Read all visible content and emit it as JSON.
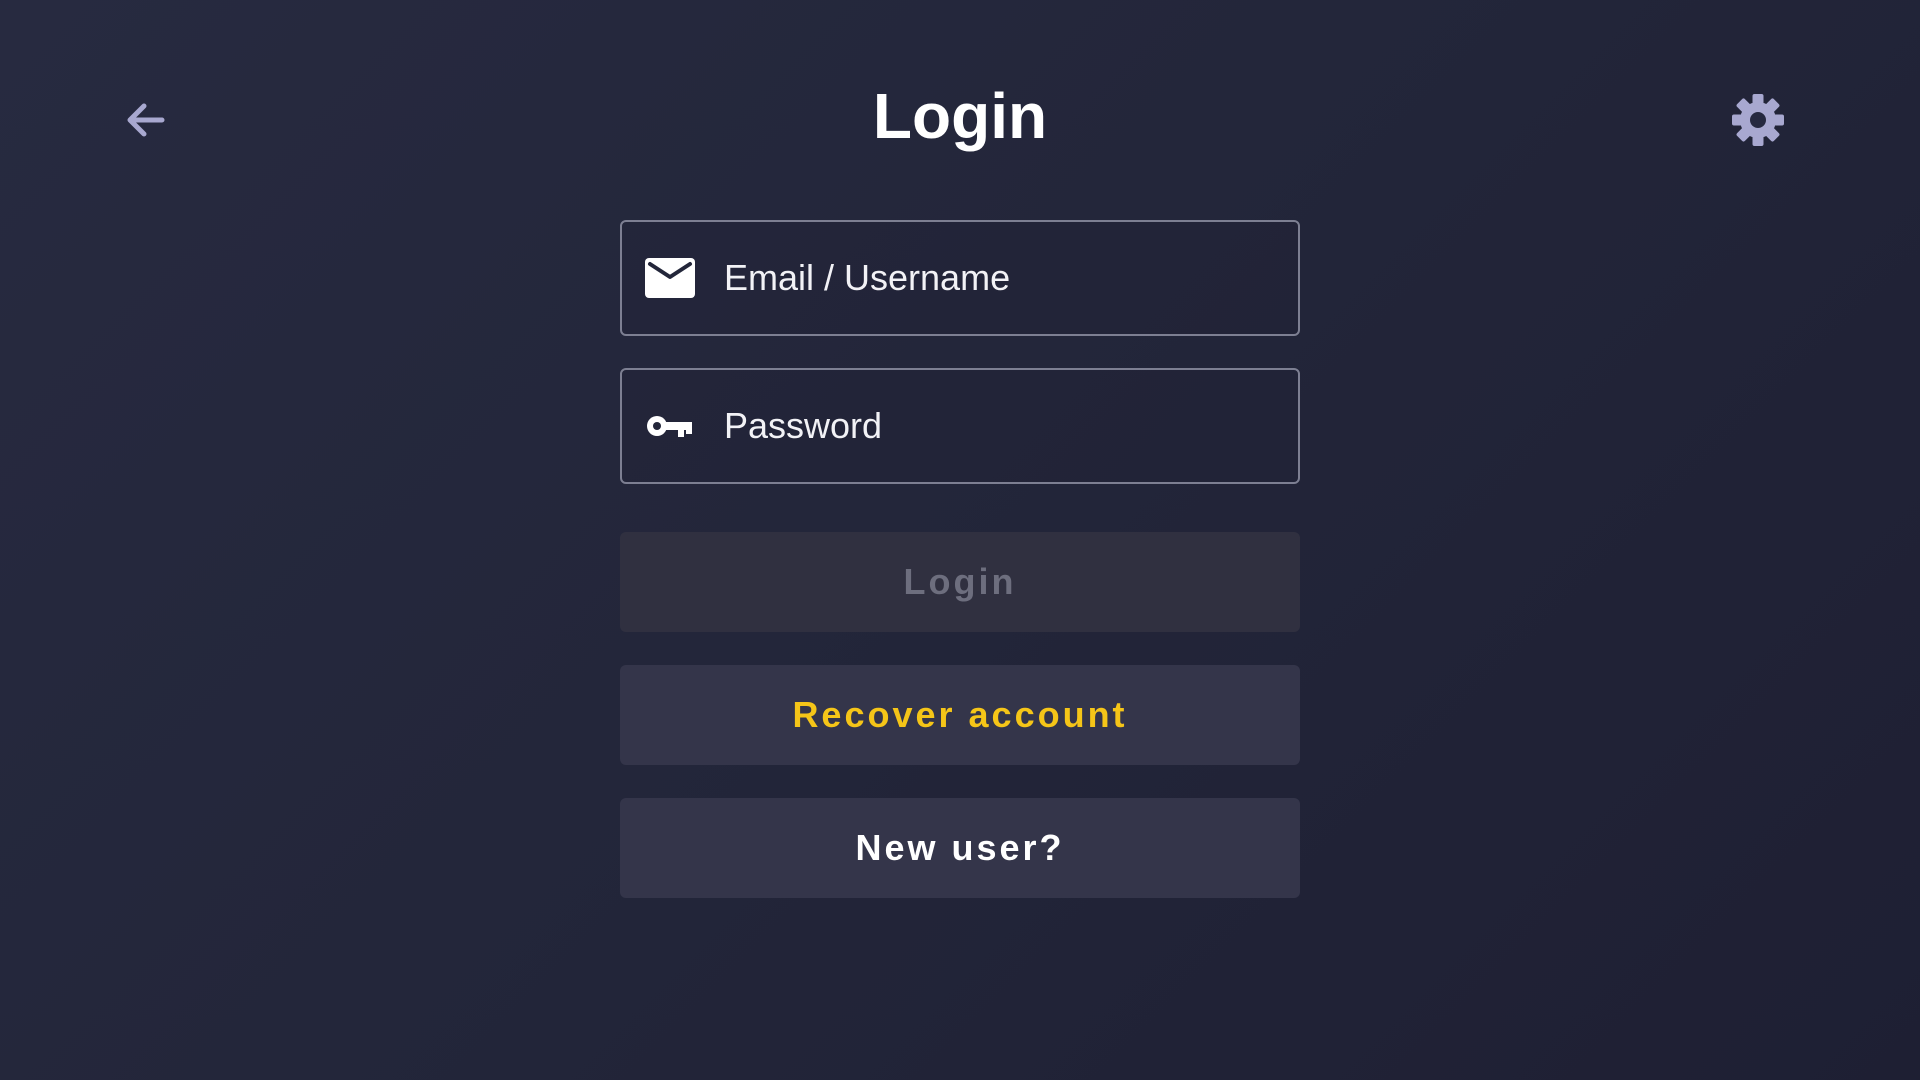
{
  "header": {
    "title": "Login",
    "back_icon": "arrow-back-icon",
    "settings_icon": "gear-icon"
  },
  "form": {
    "email": {
      "placeholder": "Email / Username",
      "value": "",
      "icon": "mail-icon"
    },
    "password": {
      "placeholder": "Password",
      "value": "",
      "icon": "key-icon"
    }
  },
  "buttons": {
    "login": {
      "label": "Login",
      "state": "disabled"
    },
    "recover": {
      "label": "Recover account"
    },
    "new_user": {
      "label": "New user?"
    }
  },
  "colors": {
    "background": "#23263a",
    "icon_muted": "#a8a8d0",
    "field_border": "#7d7f92",
    "button_bg": "#34354a",
    "login_disabled_text": "#6d6e7e",
    "recover_text": "#f5c518",
    "text": "#ffffff"
  }
}
